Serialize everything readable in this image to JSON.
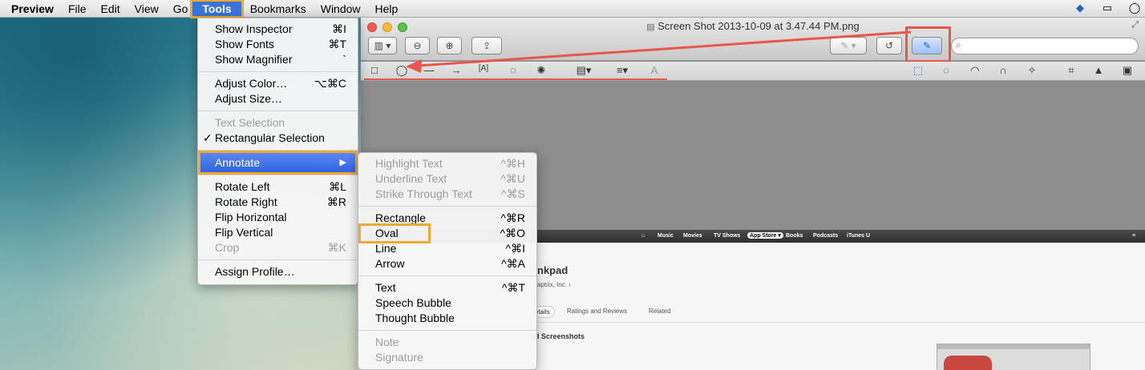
{
  "menubar": {
    "apple": "",
    "app": "Preview",
    "items": [
      "File",
      "Edit",
      "View",
      "Go",
      "Tools",
      "Bookmarks",
      "Window",
      "Help"
    ]
  },
  "tools_menu": {
    "items": [
      {
        "label": "Show Inspector",
        "shortcut": "⌘I"
      },
      {
        "label": "Show Fonts",
        "shortcut": "⌘T"
      },
      {
        "label": "Show Magnifier",
        "shortcut": "`"
      },
      {
        "label": "Adjust Color…",
        "shortcut": "⌥⌘C"
      },
      {
        "label": "Adjust Size…",
        "shortcut": ""
      },
      {
        "label": "Text Selection",
        "shortcut": ""
      },
      {
        "label": "Rectangular Selection",
        "shortcut": "",
        "check": "✓"
      },
      {
        "label": "Annotate",
        "shortcut": "",
        "arrow": "▶"
      },
      {
        "label": "Rotate Left",
        "shortcut": "⌘L"
      },
      {
        "label": "Rotate Right",
        "shortcut": "⌘R"
      },
      {
        "label": "Flip Horizontal",
        "shortcut": ""
      },
      {
        "label": "Flip Vertical",
        "shortcut": ""
      },
      {
        "label": "Crop",
        "shortcut": "⌘K"
      },
      {
        "label": "Assign Profile…",
        "shortcut": ""
      }
    ]
  },
  "annotate_menu": {
    "items": [
      {
        "label": "Highlight Text",
        "shortcut": "^⌘H"
      },
      {
        "label": "Underline Text",
        "shortcut": "^⌘U"
      },
      {
        "label": "Strike Through Text",
        "shortcut": "^⌘S"
      },
      {
        "label": "Rectangle",
        "shortcut": "^⌘R"
      },
      {
        "label": "Oval",
        "shortcut": "^⌘O"
      },
      {
        "label": "Line",
        "shortcut": "^⌘I"
      },
      {
        "label": "Arrow",
        "shortcut": "^⌘A"
      },
      {
        "label": "Text",
        "shortcut": "^⌘T"
      },
      {
        "label": "Speech Bubble",
        "shortcut": ""
      },
      {
        "label": "Thought Bubble",
        "shortcut": ""
      },
      {
        "label": "Note",
        "shortcut": ""
      },
      {
        "label": "Signature",
        "shortcut": ""
      }
    ]
  },
  "window": {
    "title": "Screen Shot 2013-10-09 at 3.47.44 PM.png",
    "search_placeholder": ""
  },
  "itunes": {
    "nav": [
      "Music",
      "Movies",
      "TV Shows",
      "App Store ▾",
      "Books",
      "Podcasts",
      "iTunes U"
    ],
    "app_name_fragment": "nkpad",
    "developer_fragment": "aptrix, Inc. ›",
    "tabs": [
      "Details",
      "Ratings and Reviews",
      "Related"
    ],
    "tab_fragment": "etails",
    "section_fragment": "ad Screenshots"
  },
  "colors": {
    "highlight_outline": "#f0a830",
    "arrow": "#e8564c",
    "menu_selection": "#3875d7"
  }
}
